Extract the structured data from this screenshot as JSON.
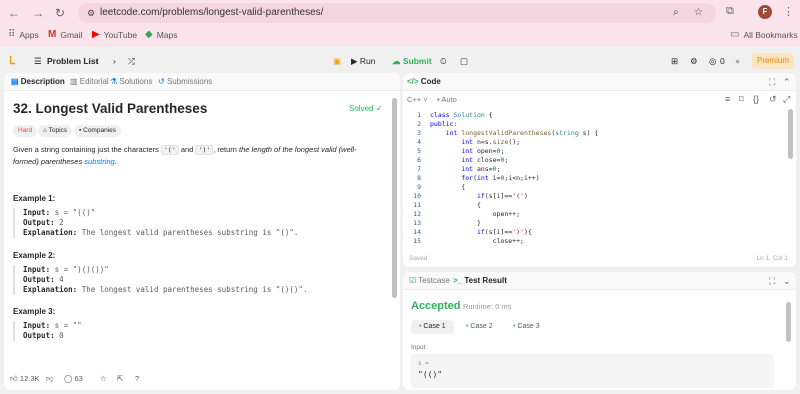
{
  "browser": {
    "url": "leetcode.com/problems/longest-valid-parentheses/",
    "profile_initial": "F",
    "bookmarks": [
      {
        "label": "Apps",
        "icon": "grid-icon"
      },
      {
        "label": "Gmail",
        "icon": "gmail-icon"
      },
      {
        "label": "YouTube",
        "icon": "youtube-icon"
      },
      {
        "label": "Maps",
        "icon": "maps-icon"
      }
    ],
    "all_bookmarks": "All Bookmarks"
  },
  "header": {
    "problem_list": "Problem List",
    "run": "Run",
    "submit": "Submit",
    "premium": "Premium",
    "fire_count": "0"
  },
  "left": {
    "tabs": [
      "Description",
      "Editorial",
      "Solutions",
      "Submissions"
    ],
    "title": "32. Longest Valid Parentheses",
    "solved": "Solved",
    "tags": [
      "Hard",
      "Topics",
      "Companies"
    ],
    "desc": {
      "p1": "Given a string containing just the characters ",
      "c1": "'('",
      "p2": " and ",
      "c2": "')'",
      "p3": ", return ",
      "em": "the length of the longest valid (well-formed) parentheses ",
      "link": "substring",
      "end": "."
    },
    "examples": [
      {
        "title": "Example 1:",
        "input": "s = \"(()\"",
        "output": "2",
        "explanation": "The longest valid parentheses substring is \"()\"."
      },
      {
        "title": "Example 2:",
        "input": "s = \")()())\"",
        "output": "4",
        "explanation": "The longest valid parentheses substring is \"()()\"."
      },
      {
        "title": "Example 3:",
        "input": "s = \"\"",
        "output": "0"
      }
    ],
    "labels": {
      "input": "Input:",
      "output": "Output:",
      "explanation": "Explanation:"
    },
    "footer": {
      "likes": "12.3K",
      "comments": "63"
    }
  },
  "code": {
    "tab": "Code",
    "lang": "C++",
    "auto": "Auto",
    "saved": "Saved",
    "cursor": "Ln 1, Col 1",
    "lines": [
      "class Solution {",
      "public:",
      "    int longestValidParentheses(string s) {",
      "        int n=s.size();",
      "        int open=0;",
      "        int close=0;",
      "        int ans=0;",
      "        for(int i=0;i<n;i++)",
      "        {",
      "            if(s[i]=='(')",
      "            {",
      "                open++;",
      "            }",
      "            if(s[i]==')'){",
      "                close++;"
    ]
  },
  "result": {
    "tabs": [
      "Testcase",
      "Test Result"
    ],
    "status": "Accepted",
    "runtime": "Runtime: 0 ms",
    "cases": [
      "Case 1",
      "Case 2",
      "Case 3"
    ],
    "input_label": "Input",
    "var": "s =",
    "value": "\"(()\""
  },
  "colors": {
    "accent_green": "#2db55d",
    "hard_red": "#ef4743",
    "brand_orange": "#f89f1b"
  }
}
